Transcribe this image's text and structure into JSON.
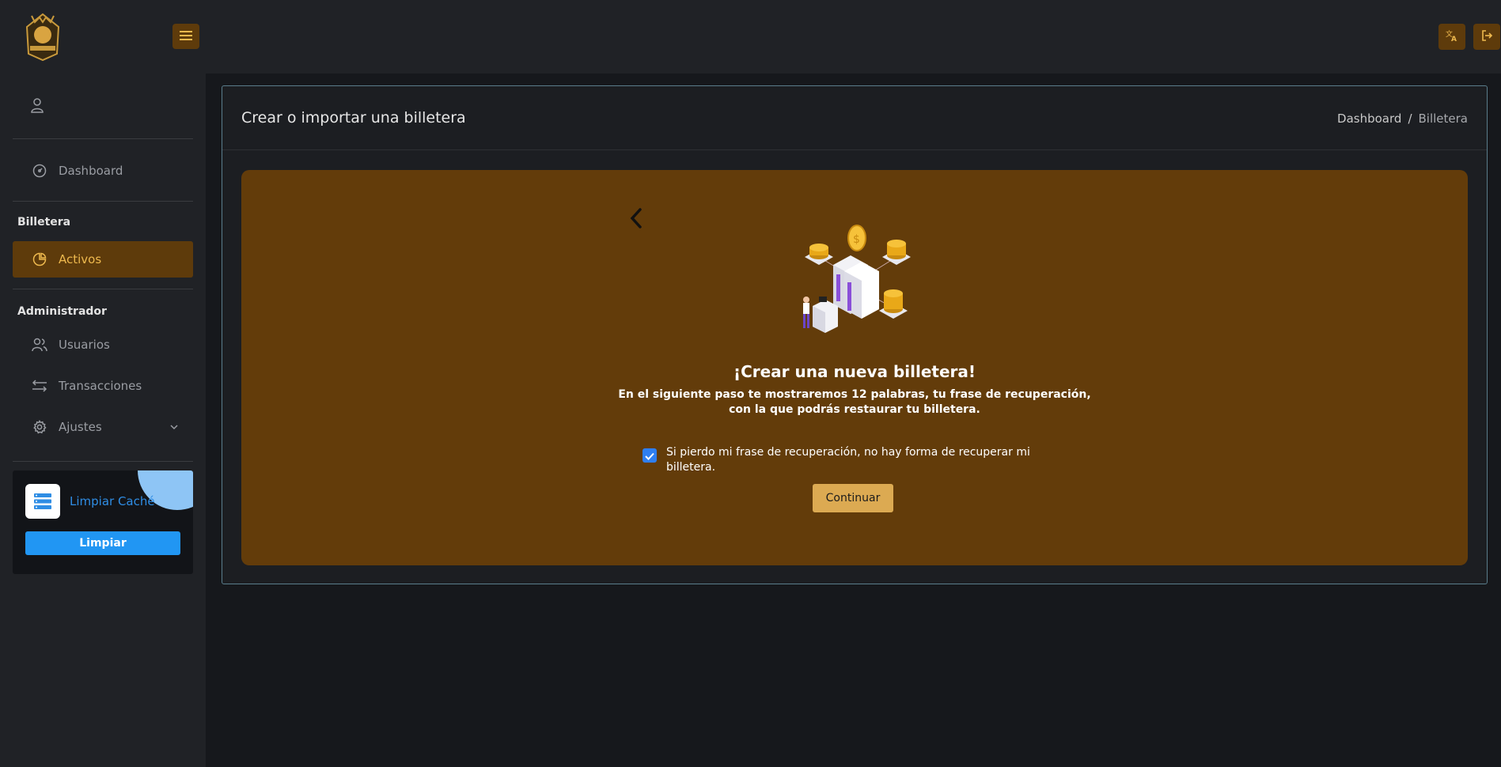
{
  "header": {
    "menu_icon": "hamburger-icon",
    "translate_icon": "translate-icon",
    "logout_icon": "logout-icon"
  },
  "sidebar": {
    "user_icon": "user-icon",
    "dashboard_label": "Dashboard",
    "section_wallet": "Billetera",
    "assets_label": "Activos",
    "section_admin": "Administrador",
    "users_label": "Usuarios",
    "transactions_label": "Transacciones",
    "settings_label": "Ajustes",
    "cache": {
      "title": "Limpiar Caché",
      "button": "Limpiar"
    }
  },
  "page": {
    "title": "Crear o importar una billetera",
    "breadcrumb": [
      "Dashboard",
      "/",
      "Billetera"
    ]
  },
  "wallet": {
    "title": "¡Crear una nueva billetera!",
    "description": "En el siguiente paso te mostraremos 12 palabras, tu frase de recuperación, con la que podrás restaurar tu billetera.",
    "confirmation": "Si pierdo mi frase de recuperación, no hay forma de recuperar mi billetera.",
    "confirmation_checked": true,
    "continue_button": "Continuar"
  },
  "colors": {
    "accent": "#5e3b0b",
    "accent_text": "#eeb94e",
    "panel": "#633c0a",
    "button": "#dcaa52",
    "cache_button": "#2196f3"
  }
}
